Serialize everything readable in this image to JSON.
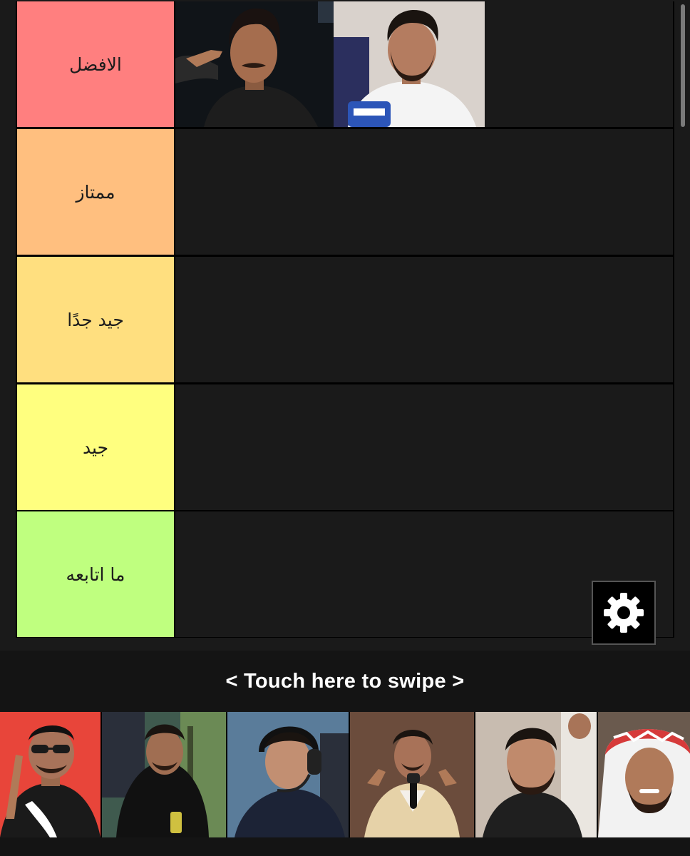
{
  "tiers": [
    {
      "label": "الافضل",
      "color": "#ff7f7f"
    },
    {
      "label": "ممتاز",
      "color": "#ffbf7f"
    },
    {
      "label": "جيد جدًا",
      "color": "#ffdf7f"
    },
    {
      "label": "جيد",
      "color": "#ffff7f"
    },
    {
      "label": "ما اتابعه",
      "color": "#bfff7f"
    }
  ],
  "swipe": {
    "label": "< Touch here to swipe >"
  },
  "settings": {
    "icon": "gear-icon"
  }
}
